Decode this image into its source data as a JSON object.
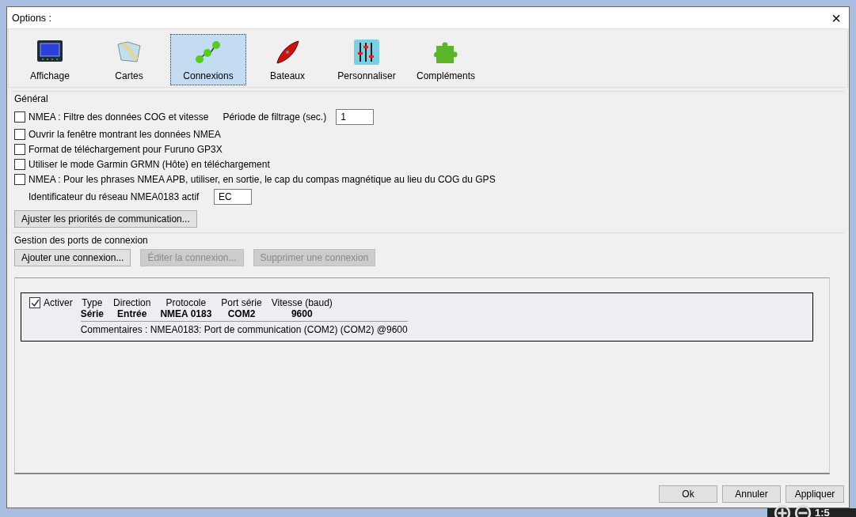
{
  "window": {
    "title": "Options :",
    "close": "×"
  },
  "tabs": [
    {
      "label": "Affichage",
      "kind": "display",
      "selected": false
    },
    {
      "label": "Cartes",
      "kind": "charts",
      "selected": false
    },
    {
      "label": "Connexions",
      "kind": "connections",
      "selected": true
    },
    {
      "label": "Bateaux",
      "kind": "boat",
      "selected": false
    },
    {
      "label": "Personnaliser",
      "kind": "sliders",
      "selected": false
    },
    {
      "label": "Compléments",
      "kind": "plugin",
      "selected": false
    }
  ],
  "general": {
    "title": "Général",
    "filter": {
      "label": "NMEA : Filtre des données COG et vitesse",
      "checked": false,
      "field_label": "Période de filtrage (sec.)",
      "field_value": "1"
    },
    "checkboxes": [
      {
        "label": "Ouvrir la fenêtre montrant les données NMEA",
        "checked": false
      },
      {
        "label": "Format de téléchargement pour Furuno GP3X",
        "checked": false
      },
      {
        "label": "Utiliser le mode Garmin GRMN (Hôte) en téléchargement",
        "checked": false
      },
      {
        "label": "NMEA : Pour les phrases NMEA APB, utiliser, en sortie, le cap du compas magnétique  au lieu du COG du GPS",
        "checked": false
      }
    ],
    "network_id": {
      "label": "Identificateur du réseau NMEA0183 actif",
      "value": "EC"
    },
    "priorities_button": "Ajuster les priorités de communication..."
  },
  "connections": {
    "title": "Gestion des ports de connexion",
    "buttons": [
      {
        "label": "Ajouter une connexion...",
        "disabled": false
      },
      {
        "label": "Éditer la connexion...",
        "disabled": true
      },
      {
        "label": "Supprimer une connexion",
        "disabled": true
      }
    ],
    "entries": [
      {
        "enable_label": "Activer",
        "enabled": true,
        "columns": [
          {
            "header": "Type",
            "value": "Série"
          },
          {
            "header": "Direction",
            "value": "Entrée"
          },
          {
            "header": "Protocole",
            "value": "NMEA 0183"
          },
          {
            "header": "Port série",
            "value": "COM2"
          },
          {
            "header": "Vitesse (baud)",
            "value": "9600"
          }
        ],
        "comment": "Commentaires : NMEA0183: Port de communication (COM2) (COM2) @9600"
      }
    ]
  },
  "footer_buttons": [
    "Ok",
    "Annuler",
    "Appliquer"
  ],
  "background": {
    "scale": "1:5"
  }
}
